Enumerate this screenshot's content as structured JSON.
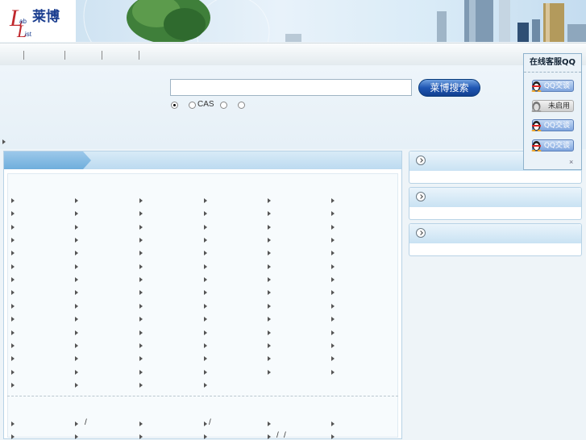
{
  "header": {
    "logo_text": "莱博",
    "logo_mark": "LabList"
  },
  "nav": {
    "items": [
      "",
      "",
      "",
      "",
      ""
    ]
  },
  "search": {
    "input_value": "",
    "button_label": "莱博搜索",
    "options": [
      {
        "label": "",
        "checked": true
      },
      {
        "label": "CAS",
        "checked": false
      },
      {
        "label": "",
        "checked": false
      },
      {
        "label": "",
        "checked": false
      }
    ]
  },
  "qq_panel": {
    "title": "在线客服QQ",
    "buttons": [
      {
        "label": "QQ交谈",
        "status": "online"
      },
      {
        "label": "未启用",
        "status": "offline"
      },
      {
        "label": "QQ交谈",
        "status": "online"
      },
      {
        "label": "QQ交谈",
        "status": "online"
      }
    ],
    "close": "×"
  },
  "colors": {
    "accent": "#1f56b3",
    "panel_border": "#b8d3e6",
    "panel_head": "#bcdaf0"
  }
}
